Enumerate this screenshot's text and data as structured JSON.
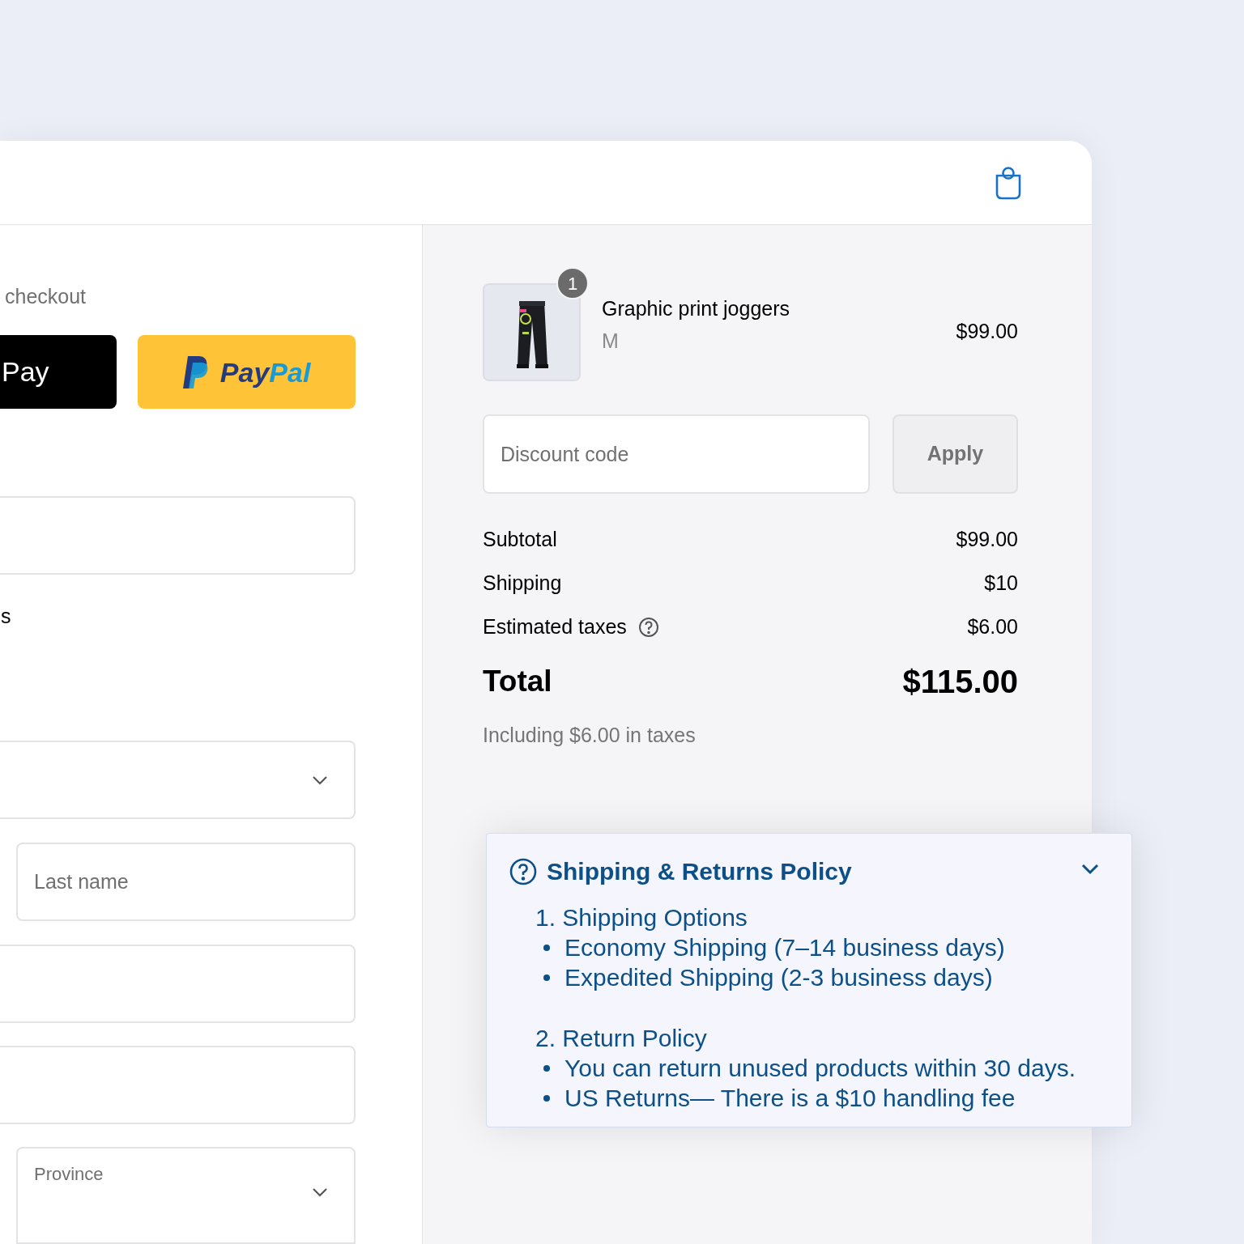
{
  "express_checkout": {
    "heading": "checkout",
    "buttons": [
      {
        "kind": "apple_pay",
        "label": "Pay"
      },
      {
        "kind": "paypal",
        "label_parts": [
          "Pay",
          "Pal"
        ]
      }
    ]
  },
  "form": [
    {
      "kind": "field"
    },
    {
      "kind": "text",
      "text": "s"
    },
    {
      "kind": "select"
    },
    {
      "kind": "half_field",
      "placeholder": "Last name"
    },
    {
      "kind": "field"
    },
    {
      "kind": "field"
    },
    {
      "kind": "half_select",
      "label": "Province"
    }
  ],
  "summary": {
    "item": {
      "name": "Graphic print joggers",
      "variant": "M",
      "price": "$99.00",
      "quantity": "1"
    },
    "discount": {
      "placeholder": "Discount code",
      "button": "Apply"
    },
    "lines": [
      {
        "label": "Subtotal",
        "value": "$99.00",
        "info": false
      },
      {
        "label": "Shipping",
        "value": "$10",
        "info": false
      },
      {
        "label": "Estimated taxes",
        "value": "$6.00",
        "info": true
      }
    ],
    "total": {
      "label": "Total",
      "value": "$115.00"
    },
    "tax_note": "Including $6.00 in taxes"
  },
  "policy": {
    "title": "Shipping & Returns Policy",
    "expanded": true,
    "sections": [
      {
        "heading": "1. Shipping Options",
        "bullets": [
          "Economy Shipping (7–14 business days)",
          "Expedited Shipping (2-3 business days)"
        ]
      },
      {
        "heading": "2. Return Policy",
        "bullets": [
          "You can return unused products within 30 days.",
          "US Returns— There is a $10 handling fee"
        ]
      }
    ]
  }
}
